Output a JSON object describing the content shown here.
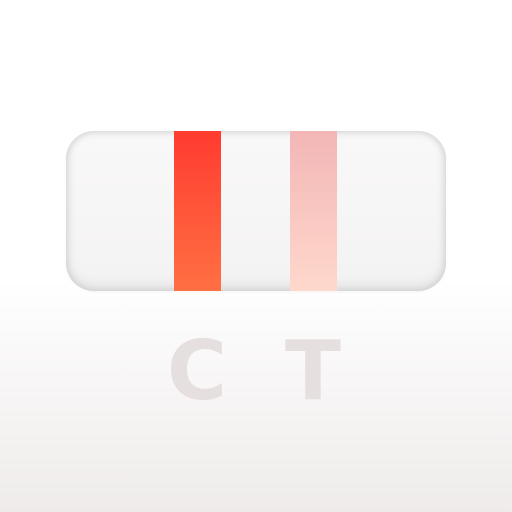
{
  "test_strip": {
    "control_line": {
      "color_top": "#ff3b30",
      "color_bottom": "#ff7043"
    },
    "test_line": {
      "color_top": "#f2b6b6",
      "color_bottom": "#ffd8cc"
    },
    "labels": {
      "control": "C",
      "test": "T"
    }
  }
}
